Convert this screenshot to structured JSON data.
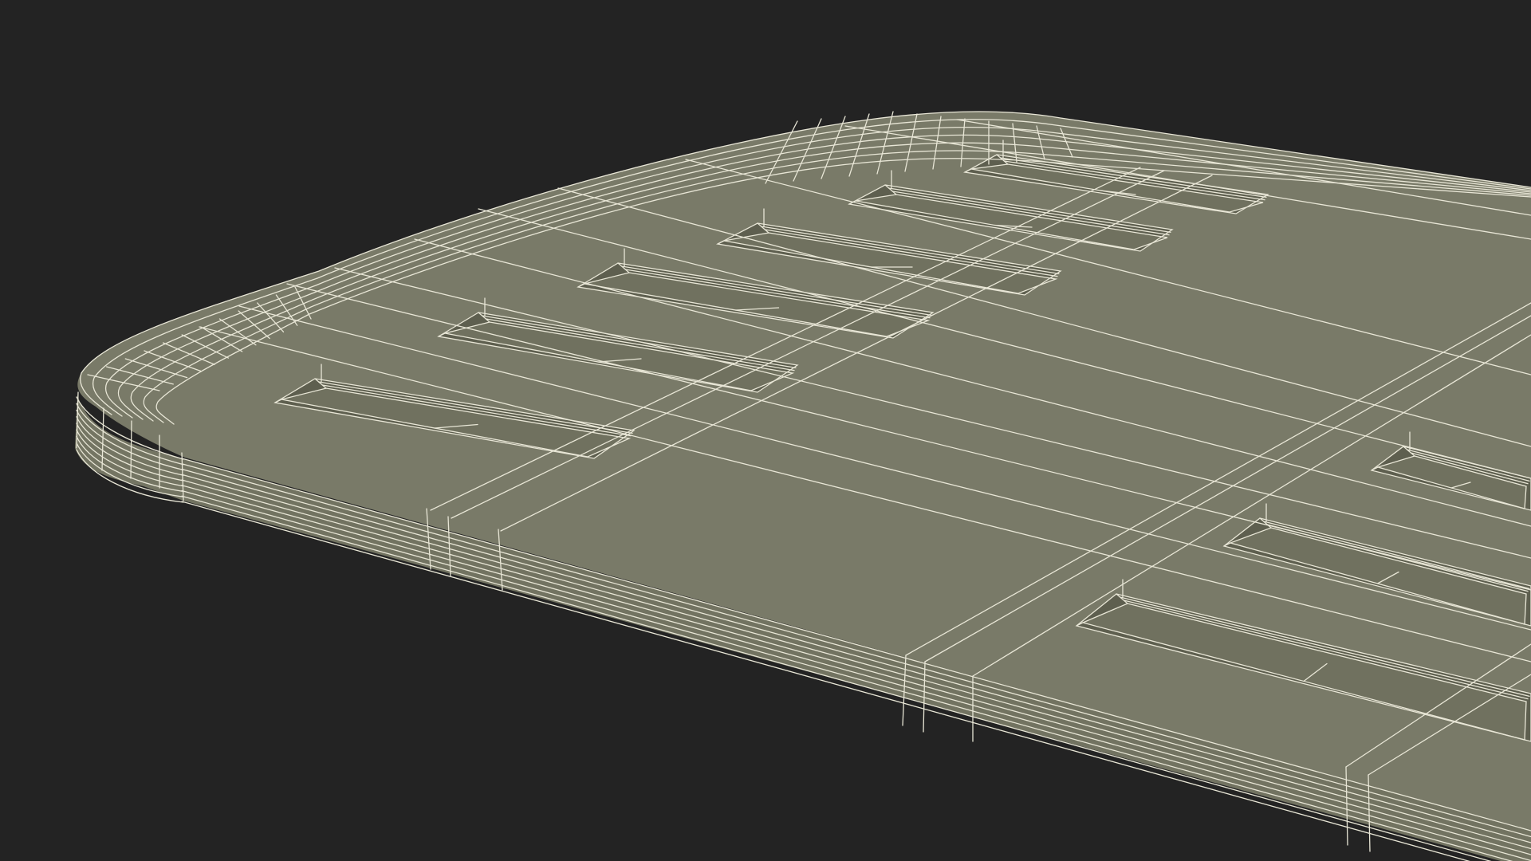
{
  "scene": {
    "subject": "",
    "colors": {
      "background": "#232323",
      "top_surface": "#797a68",
      "side_surface": "#727361",
      "pocket_floor": "#70715f",
      "pocket_wall": "#5e5f4f",
      "shadow": "#4c4d40",
      "wire": "#e8e6d6"
    }
  }
}
